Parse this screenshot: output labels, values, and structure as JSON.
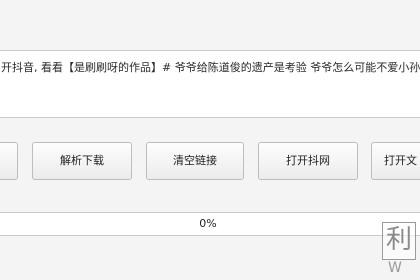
{
  "link": {
    "text": "开抖音, 看看【是刷刷呀的作品】# 爷爷给陈道俊的遗产是考验 爷爷怎么可能不爱小孙... https;"
  },
  "buttons": {
    "edge_label": "",
    "parse_label": "解析下载",
    "clear_label": "清空链接",
    "open_douyin_label": "打开抖网",
    "open_file_label": "打开文"
  },
  "progress": {
    "percent": 0,
    "label": "0%",
    "fill_color": "#06b025"
  },
  "watermark": {
    "glyph": "利",
    "letter": "W"
  }
}
